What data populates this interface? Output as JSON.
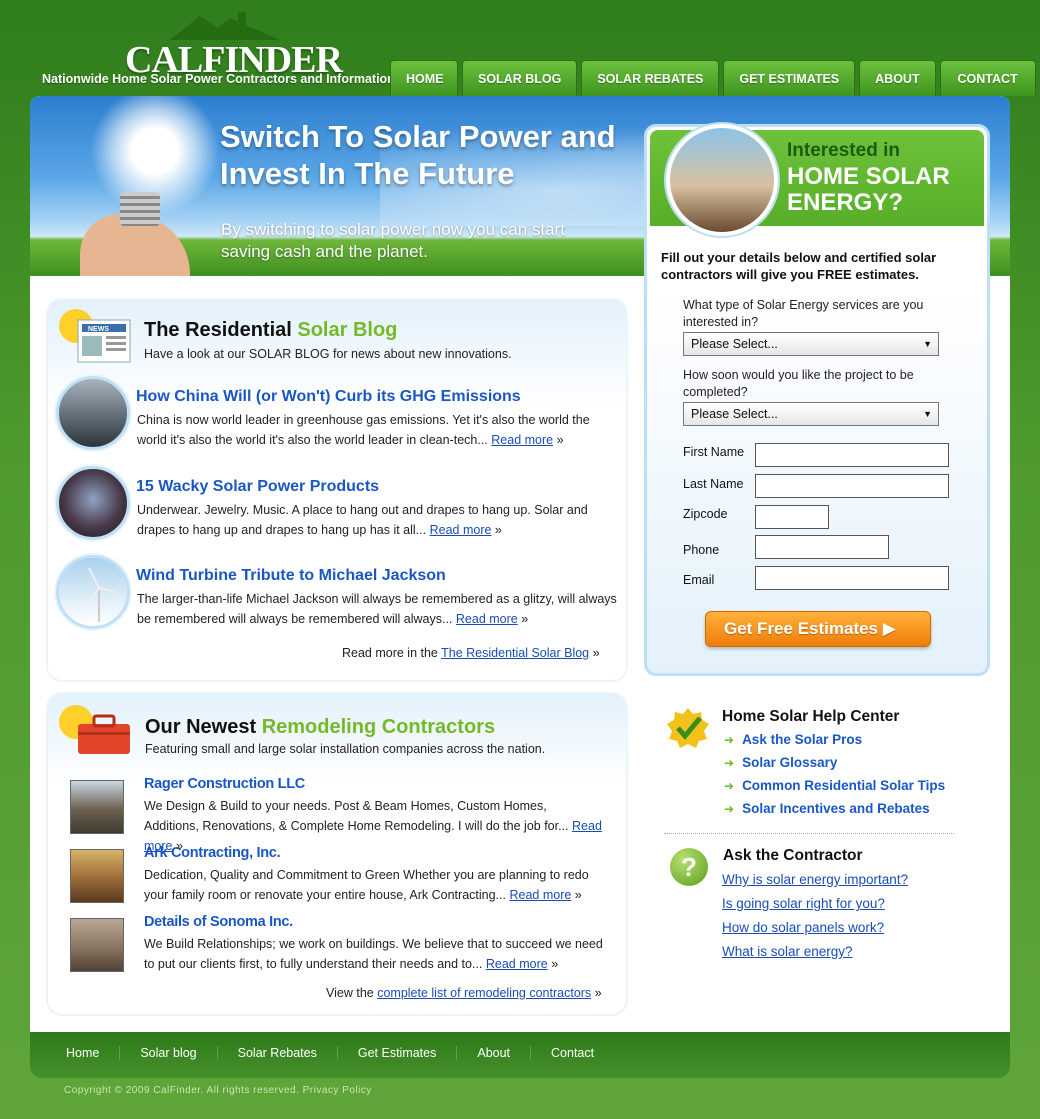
{
  "brand": {
    "logo_text": "CALFINDER",
    "tagline": "Nationwide Home Solar Power Contractors and Information"
  },
  "nav": [
    "HOME",
    "SOLAR BLOG",
    "SOLAR REBATES",
    "GET ESTIMATES",
    "ABOUT",
    "CONTACT"
  ],
  "hero": {
    "title": "Switch To Solar Power and Invest In The Future",
    "subtitle": "By switching to solar power now you can start saving cash and the planet."
  },
  "blog": {
    "title_a": "The Residential ",
    "title_b": "Solar Blog",
    "intro": "Have a look at our SOLAR BLOG for news about new innovations.",
    "icon_label": "NEWS",
    "posts": [
      {
        "title": "How China Will (or Won't) Curb its GHG Emissions",
        "text": "China is now world leader in greenhouse gas emissions. Yet it's also the world the world it's also the world it's also the world leader in clean-tech...",
        "more": "Read more"
      },
      {
        "title": "15 Wacky Solar Power Products",
        "text": "Underwear. Jewelry. Music. A place to hang out and drapes to hang up. Solar and drapes to hang up and drapes to hang up has it all...",
        "more": "Read more"
      },
      {
        "title": "Wind Turbine Tribute to Michael Jackson",
        "text": "The larger-than-life Michael Jackson will always be remembered as a glitzy, will always be remembered will always be remembered will always...",
        "more": "Read more"
      }
    ],
    "footer_prefix": "Read more in the ",
    "footer_link": "The Residential Solar Blog"
  },
  "contractors": {
    "title_a": "Our Newest ",
    "title_b": "Remodeling Contractors",
    "intro": "Featuring small and large solar installation companies across the nation.",
    "items": [
      {
        "name": "Rager Construction LLC",
        "text": "We Design & Build to your needs. Post & Beam Homes, Custom Homes, Additions, Renovations, & Complete Home Remodeling. I will do the job for...",
        "more": "Read more"
      },
      {
        "name": "Ark Contracting, Inc.",
        "text": "Dedication, Quality and Commitment to Green Whether you are planning to redo your family room or renovate your entire house, Ark Contracting...",
        "more": "Read more"
      },
      {
        "name": "Details of Sonoma Inc.",
        "text": "We Build Relationships; we work on buildings. We believe that to succeed we need to put our clients first, to fully understand their needs and to...",
        "more": "Read more"
      }
    ],
    "footer_prefix": "View the ",
    "footer_link": "complete list of remodeling contractors"
  },
  "form": {
    "heading_small": "Interested in",
    "heading_big": "HOME SOLAR ENERGY?",
    "description": "Fill out your details below and certified solar contractors will give you FREE estimates.",
    "q1": "What type of Solar Energy services are you interested in?",
    "q1_value": "Please Select...",
    "q2": "How soon would you like the project to be completed?",
    "q2_value": "Please Select...",
    "fields": {
      "first_name": "First Name",
      "last_name": "Last Name",
      "zipcode": "Zipcode",
      "phone": "Phone",
      "email": "Email"
    },
    "submit": "Get Free Estimates ▶"
  },
  "help_center": {
    "title": "Home Solar Help Center",
    "links": [
      "Ask the Solar Pros",
      "Solar Glossary",
      "Common Residential Solar Tips",
      "Solar Incentives and Rebates"
    ]
  },
  "ask": {
    "title": "Ask the Contractor",
    "icon": "?",
    "links": [
      "Why is solar energy important?",
      "Is going solar right for you?",
      "How do solar panels work?",
      "What is solar energy?"
    ]
  },
  "footer": {
    "links": [
      "Home",
      "Solar blog",
      "Solar Rebates",
      "Get Estimates",
      "About",
      "Contact"
    ],
    "copyright": "Copyright © 2009 CalFinder. All rights reserved. Privacy Policy"
  },
  "colors": {
    "brand_green": "#4f9a2d",
    "link_blue": "#1a57c4",
    "accent_green": "#74b92a",
    "cta_orange": "#f07c0a"
  }
}
